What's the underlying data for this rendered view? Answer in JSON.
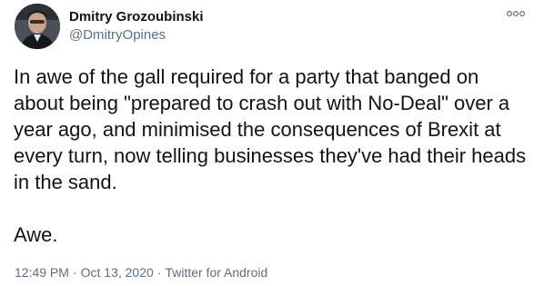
{
  "author": {
    "display_name": "Dmitry Grozoubinski",
    "handle": "@DmitryOpines"
  },
  "tweet": {
    "text": "In awe of the gall required for a party that banged on about being \"prepared to crash out with No-Deal\" over a year ago, and minimised the consequences of Brexit at every turn, now telling businesses they've had their heads in the sand.\n\nAwe."
  },
  "meta": {
    "time": "12:49 PM",
    "separator": "·",
    "date": "Oct 13, 2020",
    "source": "Twitter for Android"
  },
  "icons": {
    "more": "more-horizontal-icon"
  },
  "colors": {
    "text": "#0f1419",
    "secondary": "#5b7083",
    "background": "#ffffff"
  }
}
